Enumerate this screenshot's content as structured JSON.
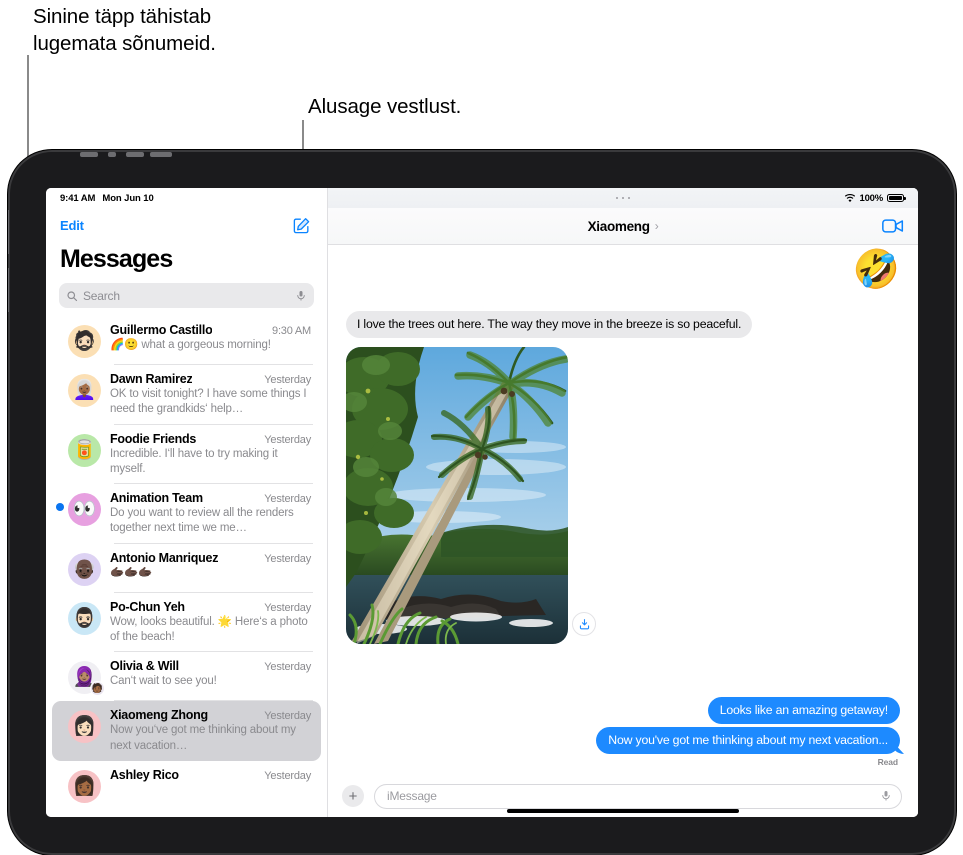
{
  "annotations": [
    {
      "id": "unread-dot-callout",
      "text": "Sinine täpp tähistab\nlugemata sõnumeid."
    },
    {
      "id": "compose-callout",
      "text": "Alusage vestlust."
    }
  ],
  "device": {
    "name": "ipad"
  },
  "sidebar": {
    "status_bar": {
      "time": "9:41 AM",
      "date": "Mon Jun 10"
    },
    "edit_label": "Edit",
    "compose_icon": "compose-icon",
    "title": "Messages",
    "search": {
      "placeholder": "Search",
      "icon": "search-icon",
      "dictation_icon": "microphone-icon"
    },
    "conversations": [
      {
        "name": "Guillermo Castillo",
        "time": "9:30 AM",
        "preview": "🌈🙂 what a gorgeous morning!",
        "avatar_emoji": "🧔🏻",
        "avatar_color": "#fbdfb4",
        "unread": false,
        "selected": false
      },
      {
        "name": "Dawn Ramirez",
        "time": "Yesterday",
        "preview": "OK to visit tonight? I have some things I need the grandkids‘ help…",
        "avatar_emoji": "👩🏾‍🦳",
        "avatar_color": "#fbdfb4",
        "unread": false,
        "selected": false
      },
      {
        "name": "Foodie Friends",
        "time": "Yesterday",
        "preview": "Incredible. I‘ll have to try making it myself.",
        "avatar_emoji": "🥫",
        "avatar_color": "#b9e8a8",
        "unread": false,
        "selected": false
      },
      {
        "name": "Animation Team",
        "time": "Yesterday",
        "preview": "Do you want to review all the renders together next time we me…",
        "avatar_emoji": "👀",
        "avatar_color": "#e7a0e0",
        "unread": true,
        "selected": false
      },
      {
        "name": "Antonio Manriquez",
        "time": "Yesterday",
        "preview": "🫱🏿🫱🏿🫱🏿",
        "avatar_emoji": "👴🏿",
        "avatar_color": "#ddd2f3",
        "unread": false,
        "selected": false
      },
      {
        "name": "Po-Chun Yeh",
        "time": "Yesterday",
        "preview": "Wow, looks beautiful. 🌟 Here‘s a photo of the beach!",
        "avatar_emoji": "🧔🏻‍♂️",
        "avatar_color": "#c9e7f6",
        "unread": false,
        "selected": false
      },
      {
        "name": "Olivia & Will",
        "time": "Yesterday",
        "preview": "Can‘t wait to see you!",
        "avatar_emoji": "🧕🏽",
        "avatar_sub_emoji": "🧑🏾",
        "avatar_color": "#f0eff3",
        "unread": false,
        "selected": false
      },
      {
        "name": "Xiaomeng Zhong",
        "time": "Yesterday",
        "preview": "Now you‘ve got me thinking about my next vacation…",
        "avatar_emoji": "👩🏻",
        "avatar_color": "#f7c2c5",
        "unread": false,
        "selected": true
      },
      {
        "name": "Ashley Rico",
        "time": "Yesterday",
        "preview": "",
        "avatar_emoji": "👩🏾",
        "avatar_color": "#f7c2c5",
        "unread": false,
        "selected": false
      }
    ]
  },
  "conversation": {
    "status_bar": {
      "wifi_icon": "wifi-icon",
      "battery_percent": "100%",
      "battery_icon": "battery-full-icon"
    },
    "title": "Xiaomeng",
    "title_chevron": "chevron-right-icon",
    "facetime_icon": "video-camera-icon",
    "reaction": {
      "emoji": "🤣",
      "name": "rofl-emoji-reaction"
    },
    "messages": [
      {
        "direction": "incoming",
        "type": "text",
        "text": "I love the trees out here. The way they move in the breeze is so peaceful."
      },
      {
        "direction": "incoming",
        "type": "photo",
        "alt": "tropical beach with palm trees"
      },
      {
        "direction": "outgoing",
        "type": "text",
        "text": "Looks like an amazing getaway!"
      },
      {
        "direction": "outgoing",
        "type": "text",
        "text": "Now you've got me thinking about my next vacation..."
      }
    ],
    "delivery_status": "Read",
    "share_icon": "share-download-icon",
    "input": {
      "plus_label": "+",
      "placeholder": "iMessage",
      "value": "",
      "dictation_icon": "microphone-icon"
    }
  },
  "colors": {
    "accent_blue": "#0a84ff",
    "bubble_out": "#1d8aff",
    "bubble_in": "#e9e9eb",
    "unread_dot": "#0a74f0",
    "selected_row": "#d2d2d6"
  }
}
